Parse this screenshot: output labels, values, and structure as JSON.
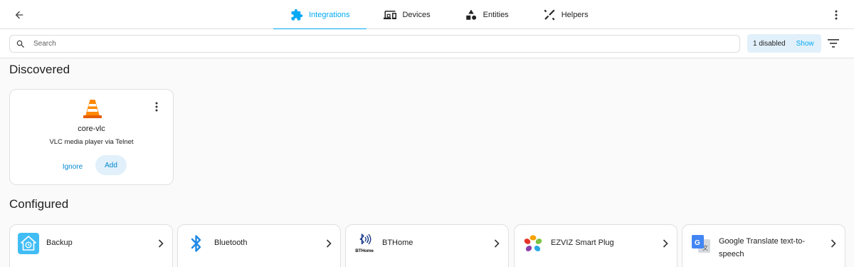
{
  "tabs": [
    {
      "label": "Integrations",
      "icon": "puzzle-icon",
      "active": true
    },
    {
      "label": "Devices",
      "icon": "devices-icon"
    },
    {
      "label": "Entities",
      "icon": "shapes-icon"
    },
    {
      "label": "Helpers",
      "icon": "tools-icon"
    }
  ],
  "search": {
    "placeholder": "Search"
  },
  "filter_chip": {
    "label": "1 disabled",
    "action": "Show"
  },
  "discovered": {
    "title": "Discovered",
    "card": {
      "name": "core-vlc",
      "description": "VLC media player via Telnet",
      "ignore_label": "Ignore",
      "add_label": "Add",
      "icon": "vlc-cone-icon"
    }
  },
  "configured": {
    "title": "Configured",
    "items": [
      {
        "name": "Backup",
        "icon": "backup-icon"
      },
      {
        "name": "Bluetooth",
        "icon": "bluetooth-icon"
      },
      {
        "name": "BTHome",
        "icon": "bthome-icon",
        "logo_text": "BTHome"
      },
      {
        "name": "EZVIZ Smart Plug",
        "icon": "ezviz-icon"
      },
      {
        "name": "Google Translate text-to-speech",
        "icon": "google-translate-icon"
      }
    ]
  },
  "colors": {
    "accent": "#03a9f4",
    "chip_bg": "#e1f0fa"
  }
}
